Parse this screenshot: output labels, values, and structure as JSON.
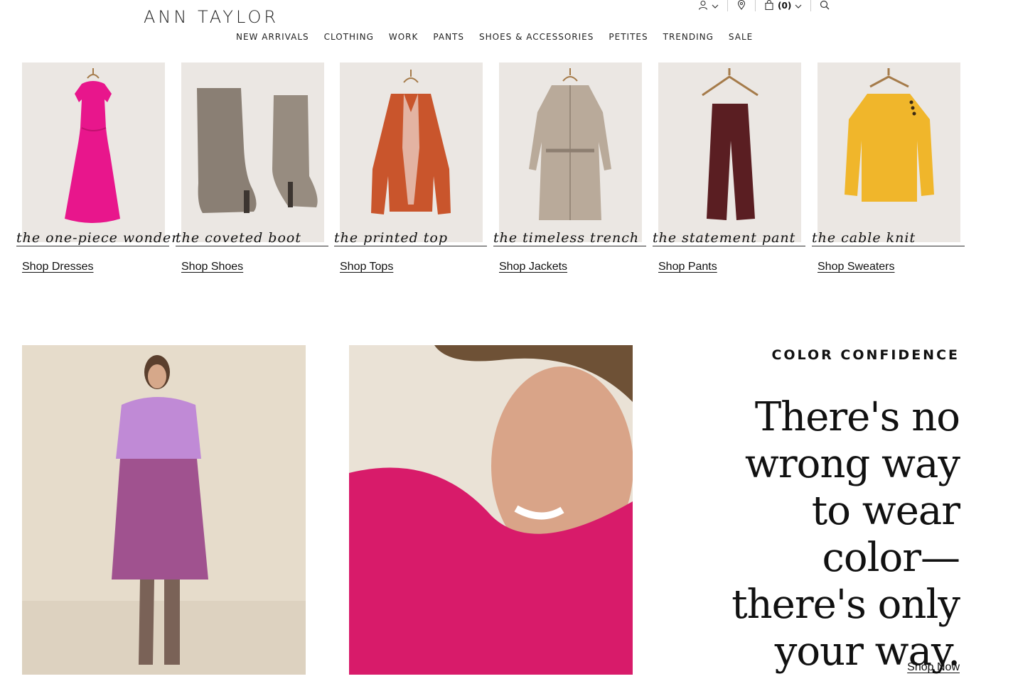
{
  "brand": {
    "logo_text": "ANN TAYLOR"
  },
  "utility": {
    "cart_count": "(0)"
  },
  "nav": {
    "items": [
      "NEW ARRIVALS",
      "CLOTHING",
      "WORK",
      "PANTS",
      "SHOES & ACCESSORIES",
      "PETITES",
      "TRENDING",
      "SALE"
    ]
  },
  "categories": [
    {
      "script": "the one-piece wonder",
      "link": "Shop Dresses",
      "icon": "dress-image"
    },
    {
      "script": "the coveted boot",
      "link": "Shop Shoes",
      "icon": "boot-image"
    },
    {
      "script": "the printed top",
      "link": "Shop Tops",
      "icon": "top-image"
    },
    {
      "script": "the timeless trench",
      "link": "Shop Jackets",
      "icon": "trench-image"
    },
    {
      "script": "the statement pant",
      "link": "Shop Pants",
      "icon": "pant-image"
    },
    {
      "script": "the cable knit",
      "link": "Shop Sweaters",
      "icon": "sweater-image"
    }
  ],
  "promo": {
    "eyebrow": "COLOR CONFIDENCE",
    "headline": "There's no wrong way to wear color—there's only your way.",
    "cta": "Shop Now"
  },
  "colors": {
    "dress": "#e8168c",
    "boot": "#8a7f74",
    "top": "#c9552c",
    "trench": "#b9aa9a",
    "pant": "#5a1e22",
    "sweater": "#f0b62b",
    "lilac_sweater": "#c08ad6",
    "pink_sweater": "#d81b6a"
  }
}
